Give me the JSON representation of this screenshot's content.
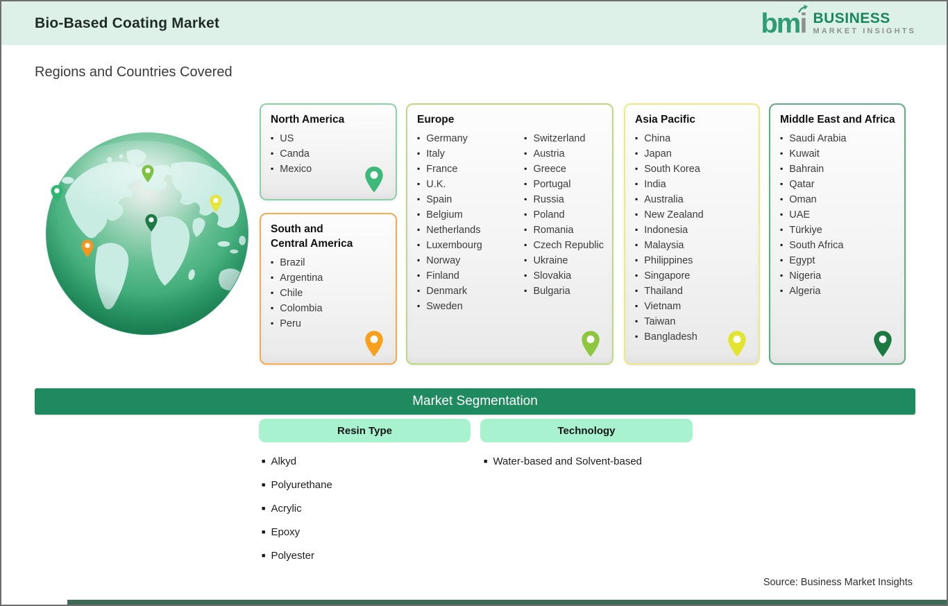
{
  "header": {
    "title": "Bio-Based Coating Market",
    "logo": {
      "mark_bm": "bm",
      "mark_i": "i",
      "line1": "BUSINESS",
      "line2": "MARKET INSIGHTS"
    }
  },
  "page": {
    "subtitle": "Regions and Countries Covered",
    "source": "Source: Business Market Insights",
    "header_bg": "#def1e8",
    "bottom_bar_color": "#3f6a57"
  },
  "globe": {
    "pin_colors": [
      "#2fb673",
      "#7dc242",
      "#e5e53a",
      "#1e7a44",
      "#f7941e"
    ],
    "ocean_color": "#2da06c",
    "land_color": "#c8ece2"
  },
  "regions": [
    {
      "title": "North America",
      "title2": "",
      "border": "#8fd0ac",
      "pin": "#3cb878",
      "countries": [
        "US",
        "Canda",
        "Mexico"
      ]
    },
    {
      "title": "South and",
      "title2": "Central America",
      "border": "#f3ac4e",
      "pin": "#f7a01b",
      "countries": [
        "Brazil",
        "Argentina",
        "Chile",
        "Colombia",
        "Peru"
      ]
    },
    {
      "title": "Europe",
      "title2": "",
      "border": "#c0d97e",
      "pin": "#8dc63f",
      "columns": [
        [
          "Germany",
          "Italy",
          "France",
          "U.K.",
          "Spain",
          "Belgium",
          "Netherlands",
          "Luxembourg",
          "Norway",
          "Finland",
          "Denmark",
          "Sweden"
        ],
        [
          "Switzerland",
          "Austria",
          "Greece",
          "Portugal",
          "Russia",
          "Poland",
          "Romania",
          "Czech Republic",
          "Ukraine",
          "Slovakia",
          "Bulgaria"
        ]
      ]
    },
    {
      "title": "Asia Pacific",
      "title2": "",
      "border": "#ecea80",
      "pin": "#e3e42f",
      "countries": [
        "China",
        "Japan",
        "South Korea",
        "India",
        "Australia",
        "New Zealand",
        "Indonesia",
        "Malaysia",
        "Philippines",
        "Singapore",
        "Thailand",
        "Vietnam",
        "Taiwan",
        "Bangladesh"
      ]
    },
    {
      "title": "Middle East and Africa",
      "title2": "",
      "border": "#62ab88",
      "pin": "#1b7a42",
      "countries": [
        "Saudi Arabia",
        "Kuwait",
        "Bahrain",
        "Qatar",
        "Oman",
        "UAE",
        "Türkiye",
        "South Africa",
        "Egypt",
        "Nigeria",
        "Algeria"
      ]
    }
  ],
  "segmentation": {
    "bar_label": "Market Segmentation",
    "bar_color": "#1f8a60",
    "pill_color": "#a9f2cf",
    "columns": [
      {
        "label": "Resin Type",
        "items": [
          "Alkyd",
          "Polyurethane",
          "Acrylic",
          "Epoxy",
          "Polyester"
        ]
      },
      {
        "label": "Technology",
        "items": [
          "Water-based and Solvent-based"
        ]
      }
    ]
  }
}
